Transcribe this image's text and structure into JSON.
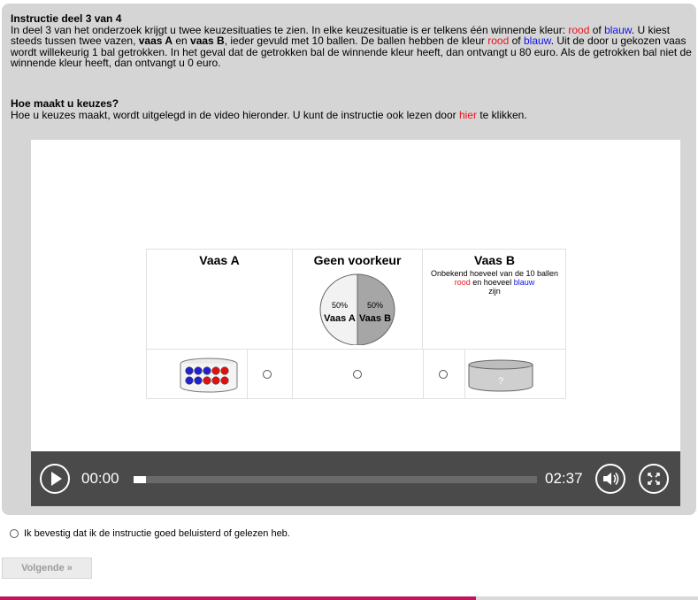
{
  "intro": {
    "title": "Instructie deel 3 van 4",
    "p1": "In deel 3 van het onderzoek krijgt u twee keuzesituaties te zien. In elke keuzesituatie is er telkens één winnende kleur: ",
    "red_word": "rood",
    "of1": " of ",
    "blue_word": "blauw",
    "p2": ". U kiest steeds tussen twee vazen, ",
    "vaasA": "vaas A",
    "en": " en ",
    "vaasB": "vaas B",
    "p3": ", ieder gevuld met 10 ballen. De ballen hebben de kleur ",
    "red_word2": "rood",
    "of2": " of ",
    "blue_word2": "blauw",
    "p4": ". Uit de door u gekozen vaas wordt willekeurig 1 bal getrokken. In het geval dat de getrokken bal de winnende kleur heeft, dan ontvangt u 80 euro. Als de getrokken bal niet de winnende kleur heeft, dan ontvangt u 0 euro."
  },
  "section2": {
    "title": "Hoe maakt u keuzes?",
    "text_before": "Hoe u keuzes maakt, wordt uitgelegd in de video hieronder. U kunt de instructie ook lezen door ",
    "link": "hier",
    "text_after": " te klikken."
  },
  "video": {
    "colA_title": "Vaas A",
    "colMid_title": "Geen voorkeur",
    "colB_title": "Vaas B",
    "colB_desc_1": "Onbekend hoeveel van de 10 ballen ",
    "colB_red": "rood",
    "colB_desc_2": " en hoeveel ",
    "colB_blue": "blauw",
    "colB_desc_3": " zijn",
    "pie_left_pct": "50%",
    "pie_right_pct": "50%",
    "pie_left_label": "Vaas A",
    "pie_right_label": "Vaas B",
    "unknown_mark": "?",
    "time_current": "00:00",
    "time_total": "02:37",
    "progress": 0.0
  },
  "confirm_text": "Ik bevestig dat ik de instructie goed beluisterd of gelezen heb.",
  "next_label": "Volgende »",
  "colors": {
    "accent": "#c0165a",
    "red": "#e8141e",
    "blue": "#1212e8"
  }
}
